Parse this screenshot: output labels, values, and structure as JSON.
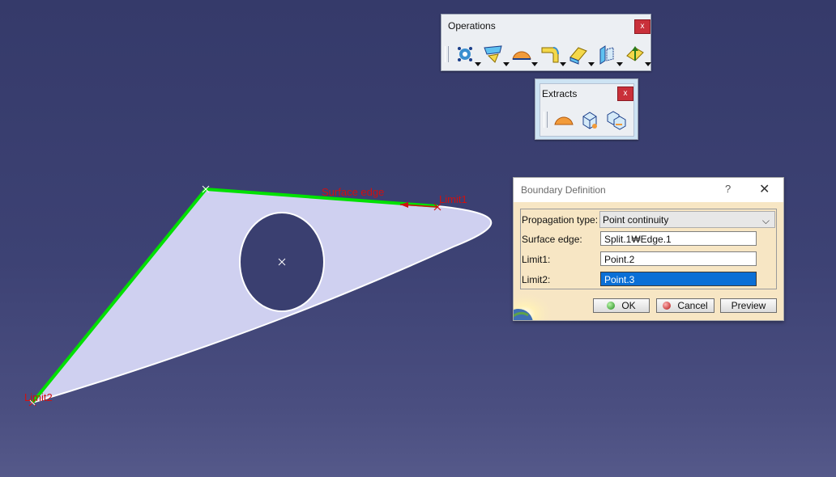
{
  "viewport": {
    "labels": {
      "surface_edge": "Surface edge",
      "limit1": "Limit1",
      "limit2": "Limit2"
    },
    "colors": {
      "surface_fill": "#cfd0f0",
      "boundary_highlight": "#00e000",
      "label_red": "#d01010"
    }
  },
  "toolbars": {
    "operations": {
      "title": "Operations",
      "close": "x",
      "icons": [
        "join-healing-icon",
        "trim-split-icon",
        "extract-boundary-icon",
        "fillet-icon",
        "transform-icon",
        "extrapolate-icon",
        "reverse-direction-icon"
      ]
    },
    "extracts": {
      "title": "Extracts",
      "close": "x",
      "icons": [
        "boundary-icon",
        "extract-icon",
        "multiple-extract-icon"
      ]
    }
  },
  "dialog": {
    "title": "Boundary Definition",
    "help": "?",
    "close": "✕",
    "propagation_type": {
      "label": "Propagation type:",
      "value": "Point continuity"
    },
    "surface_edge": {
      "label": "Surface edge:",
      "value": "Split.1₩Edge.1"
    },
    "limit1": {
      "label": "Limit1:",
      "value": "Point.2"
    },
    "limit2": {
      "label": "Limit2:",
      "value": "Point.3"
    },
    "buttons": {
      "ok": "OK",
      "cancel": "Cancel",
      "preview": "Preview"
    }
  }
}
